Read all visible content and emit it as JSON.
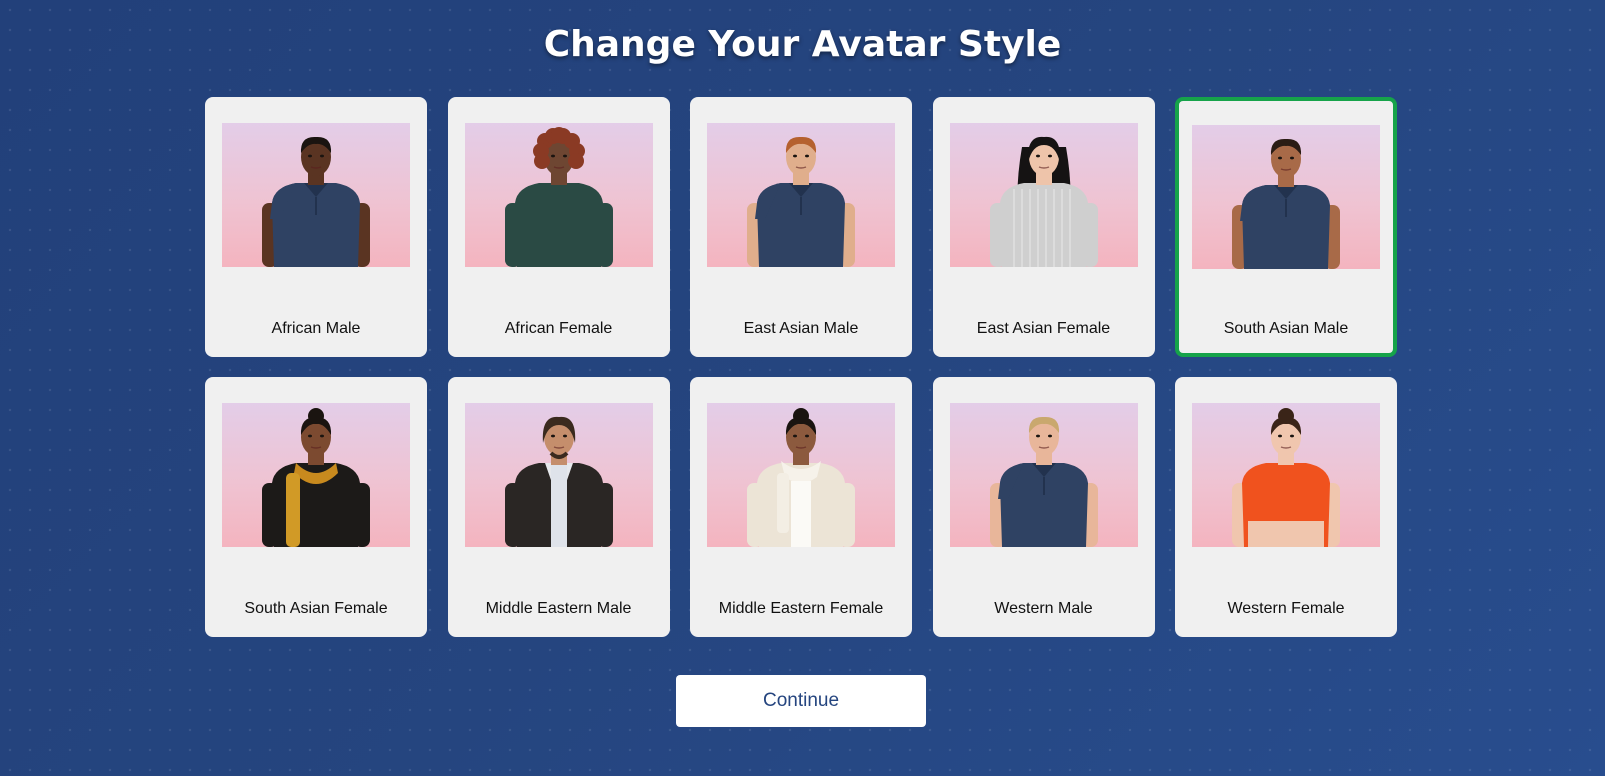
{
  "page": {
    "title": "Change Your Avatar Style"
  },
  "avatars": [
    {
      "label": "African Male",
      "skin": "#5a3422",
      "hair": "#1a1410",
      "top": "#2f4263",
      "hair_style": "short",
      "outfit": "polo",
      "selected": false
    },
    {
      "label": "African Female",
      "skin": "#6e4632",
      "hair": "#8a3a24",
      "top": "#2a4a44",
      "hair_style": "curly",
      "outfit": "sweater",
      "selected": false
    },
    {
      "label": "East Asian Male",
      "skin": "#e0ae8c",
      "hair": "#b5612f",
      "top": "#2f4263",
      "hair_style": "short",
      "outfit": "polo",
      "selected": false
    },
    {
      "label": "East Asian Female",
      "skin": "#eec4aa",
      "hair": "#151313",
      "top": "#cfcfcf",
      "hair_style": "long",
      "outfit": "knit",
      "selected": false
    },
    {
      "label": "South Asian Male",
      "skin": "#a86a48",
      "hair": "#2a1c14",
      "top": "#2f4263",
      "hair_style": "short",
      "outfit": "polo",
      "selected": true
    },
    {
      "label": "South Asian Female",
      "skin": "#7c4a30",
      "hair": "#1a1410",
      "top": "#1c1a18",
      "hair_style": "bun",
      "outfit": "kurta",
      "selected": false
    },
    {
      "label": "Middle Eastern Male",
      "skin": "#c58e6c",
      "hair": "#3a2a1e",
      "top": "#2a2624",
      "hair_style": "long-back",
      "outfit": "blazer",
      "selected": false
    },
    {
      "label": "Middle Eastern Female",
      "skin": "#8c5a3e",
      "hair": "#1a1410",
      "top": "#ece4d6",
      "hair_style": "bun",
      "outfit": "scarf",
      "selected": false
    },
    {
      "label": "Western Male",
      "skin": "#e8b69a",
      "hair": "#c9a86e",
      "top": "#2f4263",
      "hair_style": "short",
      "outfit": "polo",
      "selected": false
    },
    {
      "label": "Western Female",
      "skin": "#f0c6ae",
      "hair": "#3a2418",
      "top": "#f0521e",
      "hair_style": "bun",
      "outfit": "crop",
      "selected": false
    }
  ],
  "continue_button": {
    "label": "Continue"
  },
  "colors": {
    "background": "#25457f",
    "card": "#f0f0f0",
    "selected_border": "#16a34a",
    "button_text": "#25457f"
  }
}
